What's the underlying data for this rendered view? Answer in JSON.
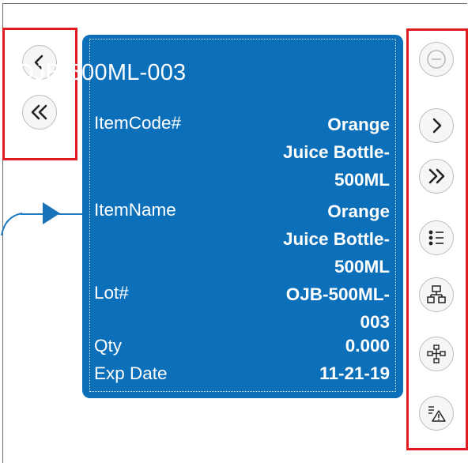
{
  "card": {
    "title": "OJB-500ML-003",
    "fields": [
      {
        "label": "ItemCode#",
        "value_lines": [
          "Orange",
          "Juice Bottle-",
          "500ML"
        ]
      },
      {
        "label": "ItemName",
        "value_lines": [
          "Orange",
          "Juice Bottle-",
          "500ML"
        ]
      },
      {
        "label": "Lot#",
        "value_lines": [
          "OJB-500ML-",
          "003"
        ]
      },
      {
        "label": "Qty",
        "value_lines": [
          "0.000"
        ]
      },
      {
        "label": "Exp Date",
        "value_lines": [
          "11-21-19"
        ]
      }
    ]
  },
  "left_controls": [
    {
      "icon": "chevron-left-icon"
    },
    {
      "icon": "double-chevron-left-icon"
    }
  ],
  "right_controls": [
    {
      "icon": "minus-circle-icon",
      "state": "disabled"
    },
    {
      "icon": "chevron-right-icon"
    },
    {
      "icon": "double-chevron-right-icon"
    },
    {
      "icon": "list-icon"
    },
    {
      "icon": "hierarchy-icon"
    },
    {
      "icon": "network-icon"
    },
    {
      "icon": "warning-list-icon"
    }
  ],
  "colors": {
    "card": "#0b6fba",
    "highlight": "#e11a22",
    "connector": "#1f7bc1"
  }
}
